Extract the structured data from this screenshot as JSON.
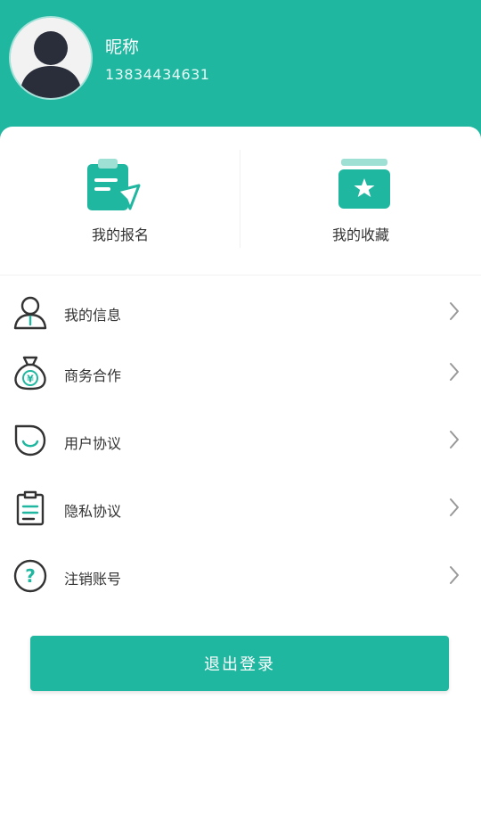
{
  "theme": {
    "accent": "#1fb7a0",
    "text": "#333333",
    "chevron": "#999999"
  },
  "profile": {
    "nickname": "昵称",
    "phone": "13834434631",
    "avatar_icon": "user-silhouette-icon"
  },
  "quick_actions": [
    {
      "label": "我的报名",
      "icon": "clipboard-edit-icon"
    },
    {
      "label": "我的收藏",
      "icon": "star-box-icon"
    }
  ],
  "menu": [
    {
      "label": "我的信息",
      "icon": "user-icon"
    },
    {
      "label": "商务合作",
      "icon": "money-bag-icon"
    },
    {
      "label": "用户协议",
      "icon": "smile-bubble-icon"
    },
    {
      "label": "隐私协议",
      "icon": "clipboard-list-icon"
    },
    {
      "label": "注销账号",
      "icon": "question-circle-icon"
    }
  ],
  "logout_label": "退出登录"
}
